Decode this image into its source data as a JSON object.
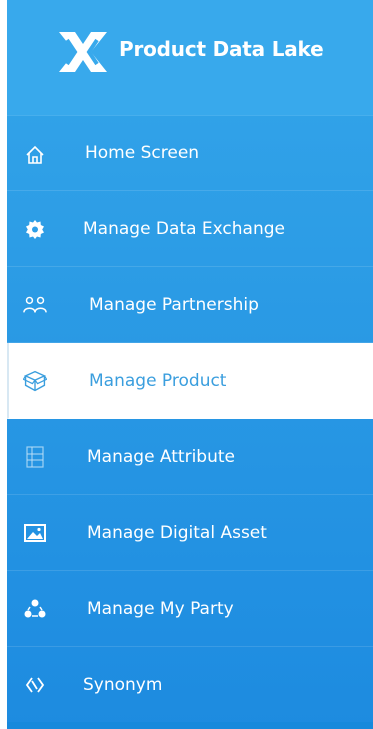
{
  "brand": {
    "title": "Product Data Lake",
    "logo_icon": "product-data-lake-logo-icon"
  },
  "colors": {
    "sidebar_top": "#34a6ea",
    "sidebar_bottom": "#1d8be0",
    "active_bg": "#ffffff",
    "active_text": "#3a9ede",
    "text": "#ffffff"
  },
  "nav": {
    "items": [
      {
        "label": "Home Screen",
        "icon": "home-icon",
        "active": false
      },
      {
        "label": "Manage Data Exchange",
        "icon": "gear-icon",
        "active": false
      },
      {
        "label": "Manage Partnership",
        "icon": "people-icon",
        "active": false
      },
      {
        "label": "Manage Product",
        "icon": "box-icon",
        "active": true
      },
      {
        "label": "Manage Attribute",
        "icon": "list-icon",
        "active": false
      },
      {
        "label": "Manage Digital Asset",
        "icon": "image-icon",
        "active": false
      },
      {
        "label": "Manage My Party",
        "icon": "party-icon",
        "active": false
      },
      {
        "label": "Synonym",
        "icon": "synonym-arrows-icon",
        "active": false
      }
    ]
  }
}
